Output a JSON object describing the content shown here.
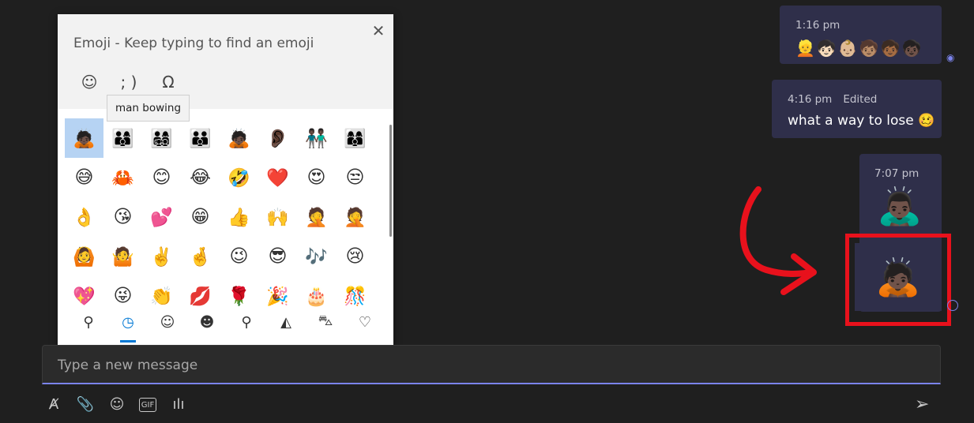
{
  "messages": [
    {
      "time": "1:16 pm",
      "emojis": "👱🧒🏻👶🏼🧒🏽🧒🏾🧒🏿"
    },
    {
      "time": "4:16 pm",
      "edited": "Edited",
      "text": "what a way to lose",
      "emoji": "🥴"
    },
    {
      "time": "7:07 pm",
      "emoji": "🙇🏿‍♂️"
    }
  ],
  "highlight_emoji": "🙇🏿",
  "picker": {
    "title": "Emoji - Keep typing to find an emoji",
    "close": "✕",
    "category_tabs": [
      "☺",
      "; )",
      "Ω"
    ],
    "tooltip": "man bowing",
    "grid": [
      "🙇🏿",
      "👨‍👩‍👦",
      "👨‍👩‍👧‍👦",
      "👨‍👨‍👦",
      "🙇🏿",
      "👂🏿",
      "👬🏿",
      "👩‍👩‍👦",
      "😅",
      "🦀",
      "😊",
      "😂",
      "🤣",
      "❤️",
      "😍",
      "😒",
      "👌",
      "😘",
      "💕",
      "😁",
      "👍",
      "🙌",
      "🤦",
      "🤦",
      "🙆",
      "🤷",
      "✌️",
      "🤞",
      "😉",
      "😎",
      "🎶",
      "😢",
      "💖",
      "😜",
      "👏",
      "💋",
      "🌹",
      "🎉",
      "🎂",
      "🎊"
    ],
    "bottom_tabs": [
      "⚲",
      "◷",
      "☺",
      "☻",
      "⚲",
      "◭",
      "⛍",
      "♡"
    ]
  },
  "compose": {
    "placeholder": "Type a new message"
  },
  "toolbar": [
    "Ⱥ",
    "📎",
    "☺",
    "GIF",
    "ılı"
  ],
  "send_icon": "➢",
  "colors": {
    "accent": "#7b83eb",
    "bubble": "#2f2f4a",
    "highlight": "#e8111c"
  }
}
